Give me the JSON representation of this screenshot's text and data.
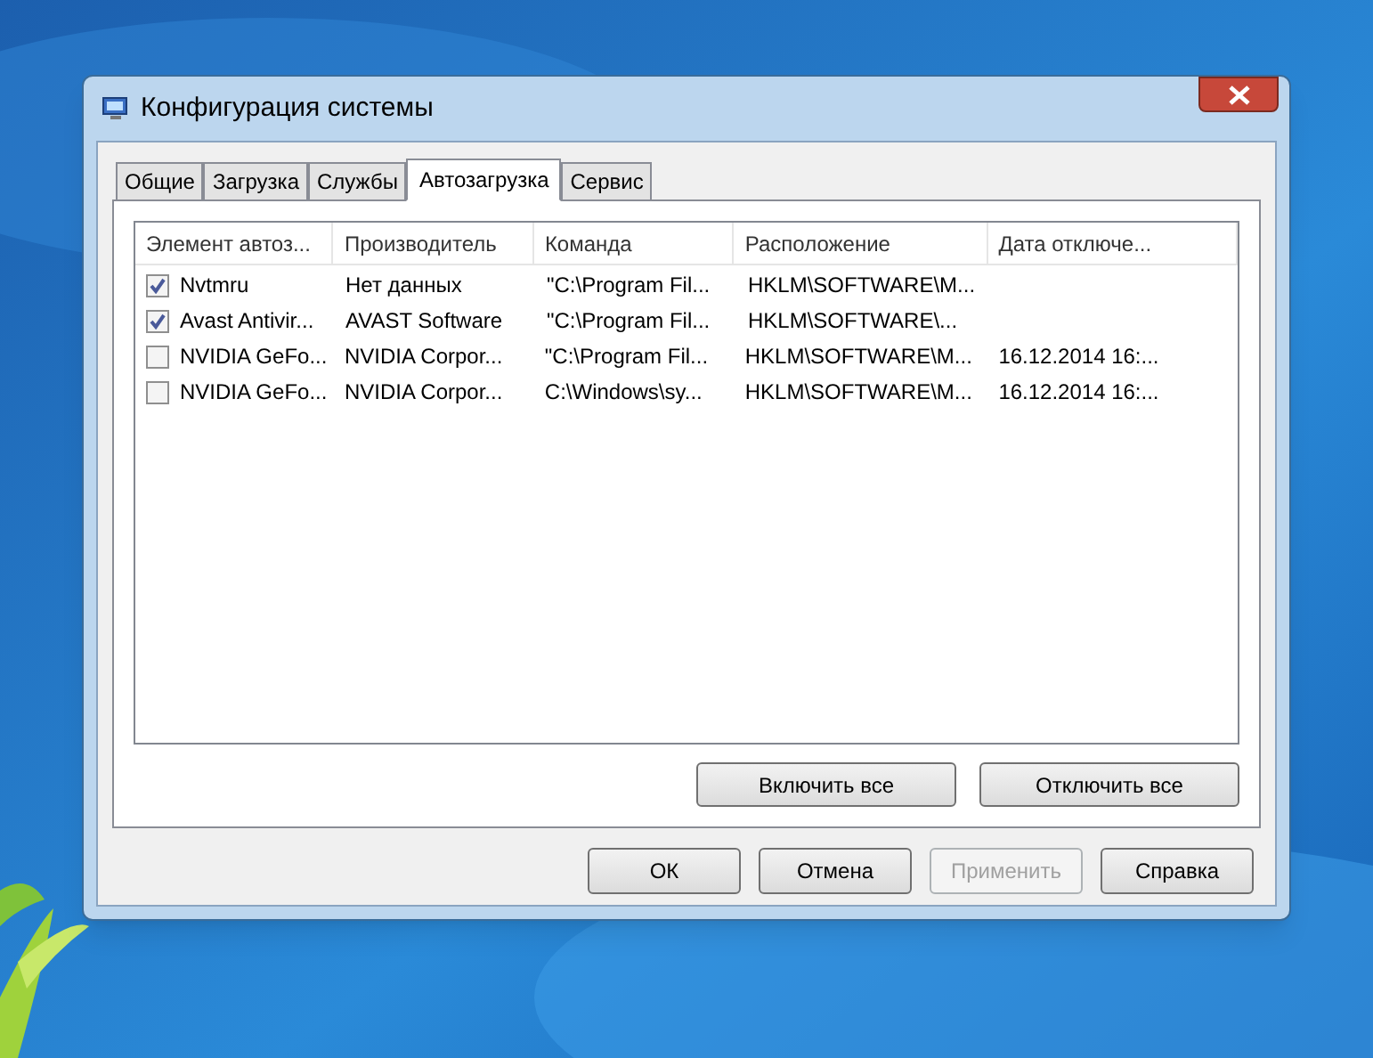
{
  "window": {
    "title": "Конфигурация системы"
  },
  "tabs": [
    {
      "label": "Общие",
      "selected": false
    },
    {
      "label": "Загрузка",
      "selected": false
    },
    {
      "label": "Службы",
      "selected": false
    },
    {
      "label": "Автозагрузка",
      "selected": true
    },
    {
      "label": "Сервис",
      "selected": false
    }
  ],
  "table": {
    "columns": [
      "Элемент автоз...",
      "Производитель",
      "Команда",
      "Расположение",
      "Дата отключе..."
    ],
    "rows": [
      {
        "checked": true,
        "cells": [
          "Nvtmru",
          "Нет данных",
          "\"C:\\Program Fil...",
          "HKLM\\SOFTWARE\\M..."
        ]
      },
      {
        "checked": true,
        "cells": [
          "Avast Antivir...",
          "AVAST Software",
          "\"C:\\Program Fil...",
          "HKLM\\SOFTWARE\\..."
        ]
      },
      {
        "checked": false,
        "cells": [
          "NVIDIA GeFo...",
          "NVIDIA Corpor...",
          "\"C:\\Program Fil...",
          "HKLM\\SOFTWARE\\M...",
          "16.12.2014 16:..."
        ]
      },
      {
        "checked": false,
        "cells": [
          "NVIDIA GeFo...",
          "NVIDIA Corpor...",
          "C:\\Windows\\sy...",
          "HKLM\\SOFTWARE\\M...",
          "16.12.2014 16:..."
        ]
      }
    ]
  },
  "panel_buttons": [
    "Включить все",
    "Отключить все"
  ],
  "buttons": [
    {
      "label": "ОК",
      "disabled": false
    },
    {
      "label": "Отмена",
      "disabled": false
    },
    {
      "label": "Применить",
      "disabled": true
    },
    {
      "label": "Справка",
      "disabled": false
    }
  ]
}
